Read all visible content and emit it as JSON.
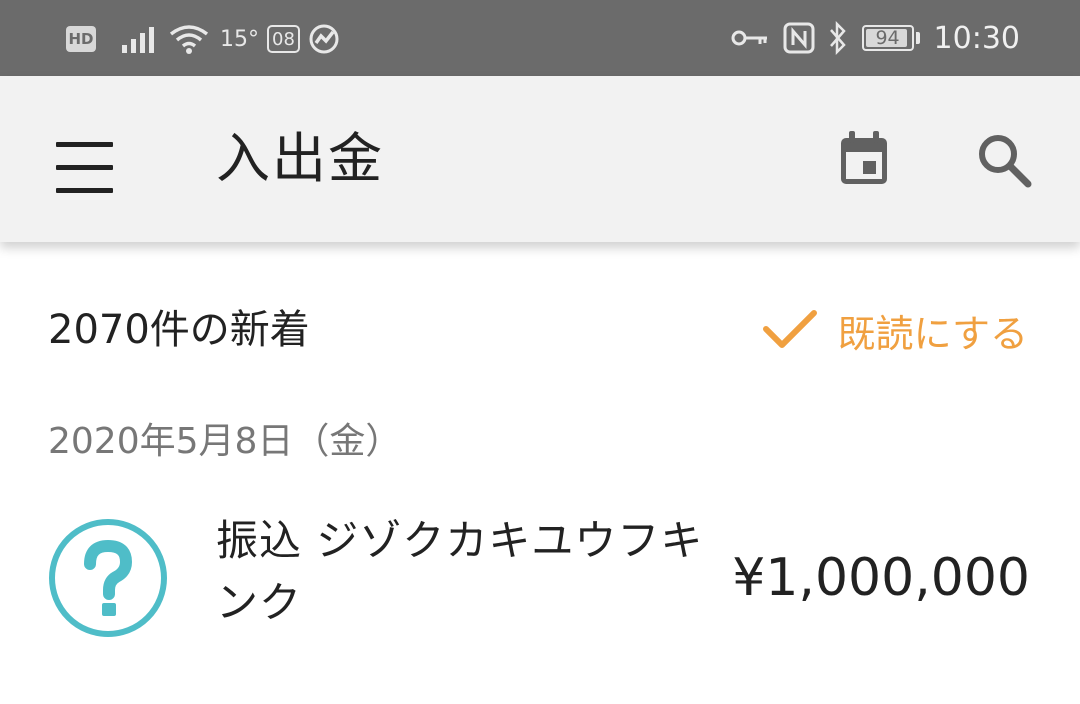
{
  "status_bar": {
    "hd_label": "HD",
    "temperature": "15°",
    "date_badge": "08",
    "battery_percent": "94",
    "battery_level": 0.94,
    "time": "10:30",
    "icons": [
      "signal-icon",
      "wifi-icon",
      "app-notification-icon",
      "key-icon",
      "nfc-icon",
      "bluetooth-icon"
    ]
  },
  "app_bar": {
    "title": "入出金",
    "menu_icon": "hamburger-menu-icon",
    "calendar_icon": "calendar-icon",
    "search_icon": "search-icon"
  },
  "new_items": {
    "count_text": "2070件の新着",
    "mark_read_label": "既読にする",
    "accent_color": "#f0a040"
  },
  "transactions": {
    "date_header": "2020年5月8日（金）",
    "items": [
      {
        "icon": "question-mark-icon",
        "description": "振込 ジゾクカキユウフキンク",
        "amount": "¥1,000,000",
        "icon_color": "#4fbdc8"
      }
    ]
  }
}
